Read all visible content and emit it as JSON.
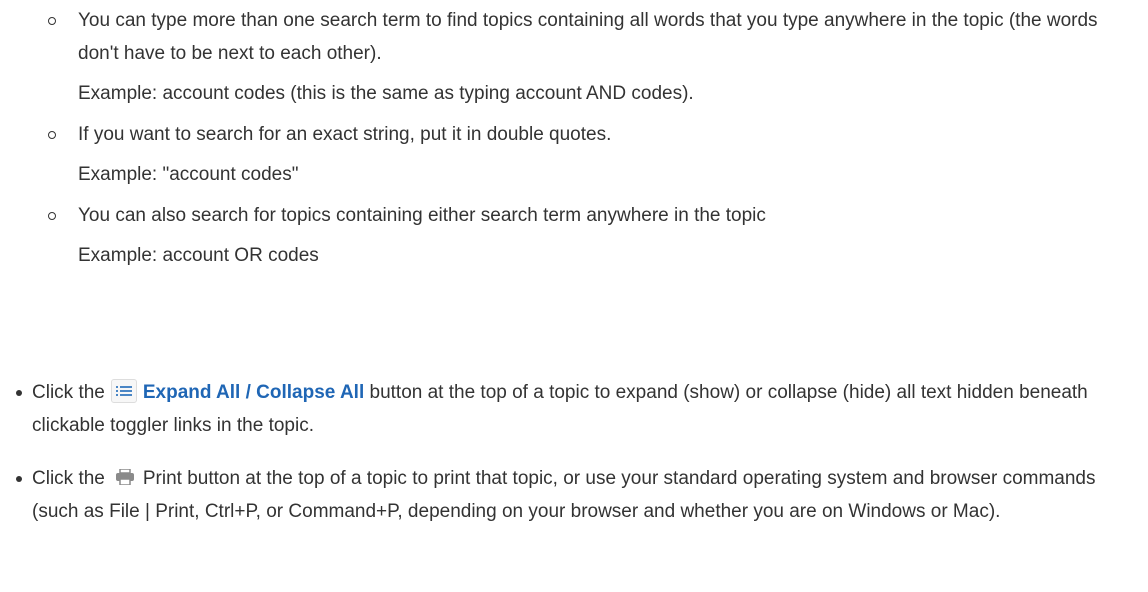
{
  "sublist": {
    "items": [
      {
        "text": "You can type more than one search term to find topics containing all words that you type anywhere in the topic (the words don't have to be next to each other).",
        "example": "Example: account codes (this is the same as typing account AND codes)."
      },
      {
        "text": "If you want to search for an exact string, put it in double quotes.",
        "example": "Example: \"account codes\""
      },
      {
        "text": "You can also search for topics containing either search term anywhere in the topic",
        "example": "Example: account OR codes"
      }
    ]
  },
  "expand_item": {
    "prefix": "Click the",
    "icon": "list-icon",
    "link_label": "Expand All / Collapse All",
    "suffix": "button at the top of a topic to expand (show) or collapse (hide) all text hidden beneath clickable toggler links in the topic."
  },
  "print_item": {
    "prefix": "Click the",
    "icon": "print-icon",
    "suffix": "Print button at the top of a topic to print that topic, or use your standard operating system and browser commands (such as File | Print, Ctrl+P, or Command+P, depending on your browser and whether you are on Windows or Mac)."
  },
  "colors": {
    "text": "#333333",
    "link": "#1f66b5",
    "icon_blue": "#4a86c5",
    "icon_gray": "#8a8a8a"
  }
}
